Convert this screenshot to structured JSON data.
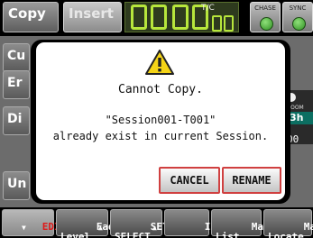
{
  "topbar": {
    "copy_tab": "Copy",
    "insert_tab": "Insert",
    "tc_label": "T/C",
    "chase_label": "CHASE",
    "sync_label": "SYNC",
    "chase_led_color": "#4fc23a",
    "sync_led_color": "#4fc23a",
    "display_color": "#b7e63c"
  },
  "side": {
    "btn1": "Cu",
    "btn2": "Er",
    "btn3": "Di",
    "btn4": "Un"
  },
  "right_panel": {
    "zoom_label": "ZOOM",
    "zoom_value": "3h",
    "sub_value": "00"
  },
  "dialog": {
    "icon": "warning-icon",
    "title": "Cannot Copy.",
    "line1": "\"Session001-T001\"",
    "line2": "already exist in current Session.",
    "cancel_label": "CANCEL",
    "rename_label": "RENAME",
    "button_border_color": "#d04040"
  },
  "bottombar": {
    "edit": "EDIT",
    "fade_level": "Fade/\nLevel",
    "set_select": "SET/\nSELECT",
    "info": "INFO",
    "mark_list": "Mark\nList",
    "manual_locate": "Manual\nLocate"
  }
}
